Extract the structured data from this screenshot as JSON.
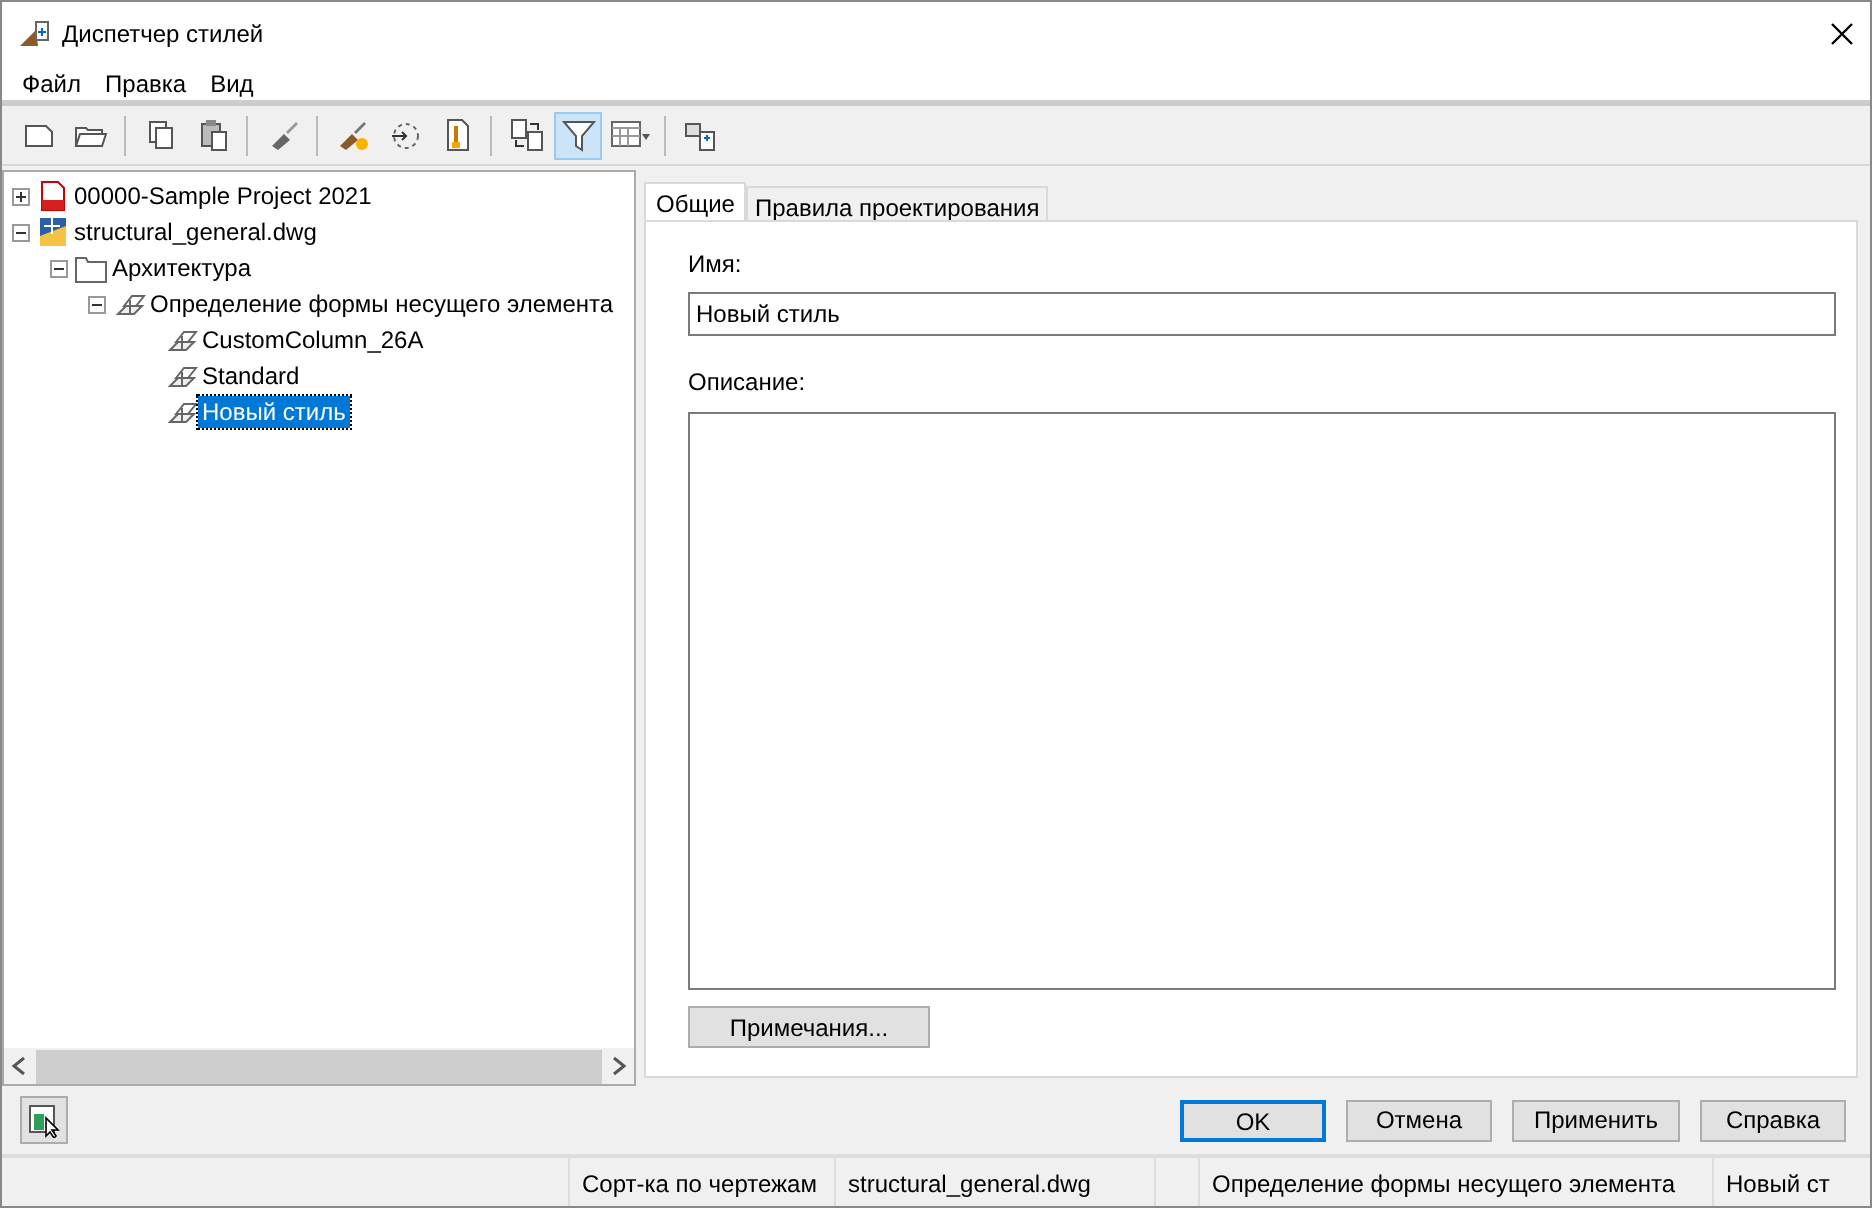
{
  "window": {
    "title": "Диспетчер стилей"
  },
  "menu": [
    "Файл",
    "Правка",
    "Вид"
  ],
  "toolbar": [
    {
      "kind": "new",
      "pressed": false
    },
    {
      "kind": "open",
      "pressed": false
    },
    {
      "kind": "sep"
    },
    {
      "kind": "copy",
      "pressed": false
    },
    {
      "kind": "paste",
      "pressed": false
    },
    {
      "kind": "sep"
    },
    {
      "kind": "brush",
      "pressed": false
    },
    {
      "kind": "sep"
    },
    {
      "kind": "brushstar",
      "pressed": false
    },
    {
      "kind": "purge",
      "pressed": false
    },
    {
      "kind": "docbrush",
      "pressed": false
    },
    {
      "kind": "sep"
    },
    {
      "kind": "compare",
      "pressed": false
    },
    {
      "kind": "filter",
      "pressed": true
    },
    {
      "kind": "view",
      "pressed": false
    },
    {
      "kind": "sep"
    },
    {
      "kind": "switch",
      "pressed": false
    }
  ],
  "tree": [
    {
      "label": "00000-Sample Project 2021",
      "kind": "pdf",
      "expanded": false,
      "selected": false
    },
    {
      "label": "structural_general.dwg",
      "kind": "dwg",
      "expanded": true,
      "selected": false,
      "children": [
        {
          "label": "Архитектура",
          "kind": "folder",
          "expanded": true,
          "selected": false,
          "children": [
            {
              "label": "Определение формы несущего элемента",
              "kind": "style",
              "expanded": true,
              "selected": false,
              "children": [
                {
                  "label": "CustomColumn_26A",
                  "kind": "style",
                  "selected": false
                },
                {
                  "label": "Standard",
                  "kind": "style",
                  "selected": false
                },
                {
                  "label": "Новый стиль",
                  "kind": "style",
                  "selected": true
                }
              ]
            }
          ]
        }
      ]
    }
  ],
  "tabs": [
    {
      "label": "Общие",
      "selected": true
    },
    {
      "label": "Правила проектирования",
      "selected": false
    }
  ],
  "form": {
    "name_label": "Имя:",
    "name_value": "Новый стиль",
    "description_label": "Описание:",
    "notes_button": "Примечания..."
  },
  "buttons": [
    {
      "label": "OK",
      "default": true
    },
    {
      "label": "Отмена",
      "default": false
    },
    {
      "label": "Применить",
      "default": false
    },
    {
      "label": "Справка",
      "default": false
    }
  ],
  "status_bar": [
    "Сорт-ка по чертежам",
    "structural_general.dwg",
    "Определение формы несущего элемента",
    "Новый ст"
  ]
}
